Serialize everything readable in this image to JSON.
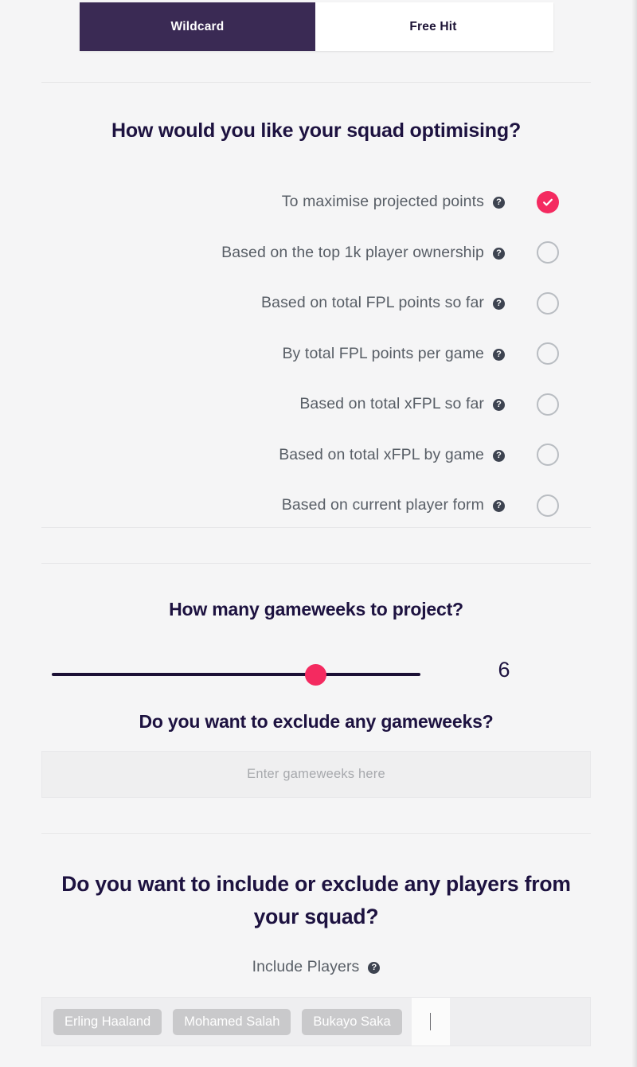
{
  "tabs": [
    {
      "label": "Wildcard",
      "active": true
    },
    {
      "label": "Free Hit",
      "active": false
    }
  ],
  "optimise": {
    "heading": "How would you like your squad optimising?",
    "options": [
      {
        "label": "To maximise projected points",
        "selected": true
      },
      {
        "label": "Based on the top 1k player ownership",
        "selected": false
      },
      {
        "label": "Based on total FPL points so far",
        "selected": false
      },
      {
        "label": "By total FPL points per game",
        "selected": false
      },
      {
        "label": "Based on total xFPL so far",
        "selected": false
      },
      {
        "label": "Based on total xFPL by game",
        "selected": false
      },
      {
        "label": "Based on current player form",
        "selected": false
      }
    ]
  },
  "gameweeks": {
    "heading": "How many gameweeks to project?",
    "value": "6",
    "slider_percent": 71
  },
  "exclude_gameweeks": {
    "heading": "Do you want to exclude any gameweeks?",
    "placeholder": "Enter gameweeks here",
    "value": ""
  },
  "players": {
    "heading": "Do you want to include or exclude any players from your squad?",
    "include_label": "Include Players",
    "chips": [
      "Erling Haaland",
      "Mohamed Salah",
      "Bukayo Saka"
    ]
  },
  "icons": {
    "help": "help-circle-icon",
    "check": "check-icon"
  },
  "colors": {
    "accent_pink": "#f42a60",
    "brand_purple": "#3a2a54",
    "heading_navy": "#1d1240",
    "page_bg": "#f5f5f6",
    "muted_text": "#585e66"
  }
}
